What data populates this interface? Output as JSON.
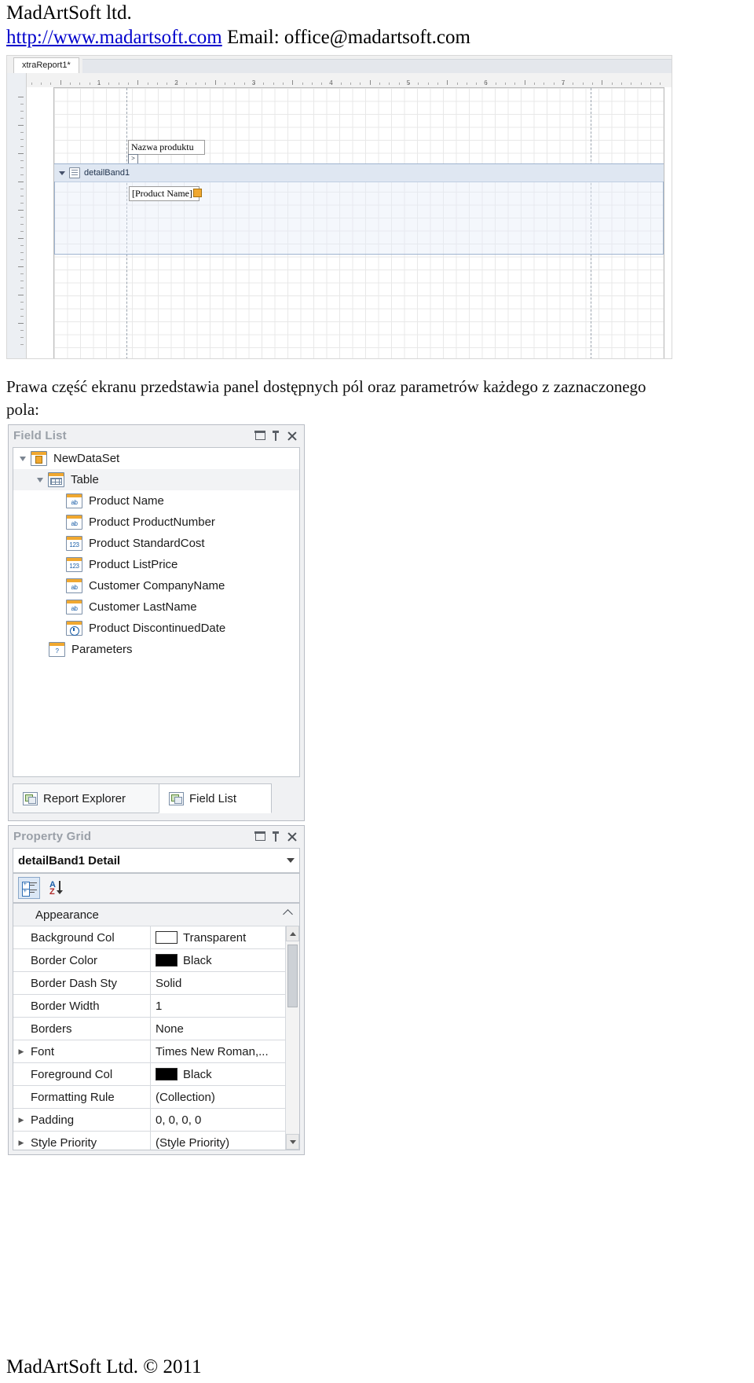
{
  "header": {
    "company": "MadArtSoft ltd.",
    "url": "http://www.madartsoft.com",
    "email_label": "Email: office@madartsoft.com"
  },
  "designer": {
    "tab_label": "xtraReport1*",
    "ruler_numbers": [
      "1",
      "2",
      "3",
      "4",
      "5",
      "6",
      "7"
    ],
    "band_label": "detailBand1",
    "label_control_text": "Nazwa produktu",
    "field_control_text": "[Product Name]",
    "smart_tag_glyph": ">"
  },
  "paragraph": "Prawa część ekranu przedstawia panel dostępnych pól oraz parametrów każdego z zaznaczonego pola:",
  "field_list": {
    "title": "Field List",
    "tree": [
      {
        "label": "NewDataSet",
        "icon": "dataset-icon",
        "indent": 0,
        "expander": true
      },
      {
        "label": "Table",
        "icon": "table-icon",
        "indent": 1,
        "expander": true
      },
      {
        "label": "Product Name",
        "icon": "string-field-icon",
        "indent": 2,
        "expander": false,
        "type": "ab"
      },
      {
        "label": "Product ProductNumber",
        "icon": "string-field-icon",
        "indent": 2,
        "expander": false,
        "type": "ab"
      },
      {
        "label": "Product StandardCost",
        "icon": "number-field-icon",
        "indent": 2,
        "expander": false,
        "type": "123"
      },
      {
        "label": "Product ListPrice",
        "icon": "number-field-icon",
        "indent": 2,
        "expander": false,
        "type": "123"
      },
      {
        "label": "Customer CompanyName",
        "icon": "string-field-icon",
        "indent": 2,
        "expander": false,
        "type": "ab"
      },
      {
        "label": "Customer LastName",
        "icon": "string-field-icon",
        "indent": 2,
        "expander": false,
        "type": "ab"
      },
      {
        "label": "Product DiscontinuedDate",
        "icon": "date-field-icon",
        "indent": 2,
        "expander": false,
        "type": "clock"
      },
      {
        "label": "Parameters",
        "icon": "parameters-icon",
        "indent": 1,
        "expander": false,
        "type": "?"
      }
    ],
    "tabs": [
      {
        "label": "Report Explorer",
        "active": false
      },
      {
        "label": "Field List",
        "active": true
      }
    ]
  },
  "property_grid": {
    "title": "Property Grid",
    "selected_object": "detailBand1  Detail",
    "toolbar": {
      "categorized": "categorized-view-button",
      "alphabetical": "alphabetical-sort-button",
      "az_a": "A",
      "az_z": "Z"
    },
    "category": "Appearance",
    "rows": [
      {
        "name": "Background Col",
        "value": "Transparent",
        "swatch": "#ffffff",
        "expandable": false
      },
      {
        "name": "Border Color",
        "value": "Black",
        "swatch": "#000000",
        "expandable": false
      },
      {
        "name": "Border Dash Sty",
        "value": "Solid",
        "swatch": null,
        "expandable": false
      },
      {
        "name": "Border Width",
        "value": "1",
        "swatch": null,
        "expandable": false
      },
      {
        "name": "Borders",
        "value": "None",
        "swatch": null,
        "expandable": false
      },
      {
        "name": "Font",
        "value": "Times New Roman,...",
        "swatch": null,
        "expandable": true
      },
      {
        "name": "Foreground Col",
        "value": "Black",
        "swatch": "#000000",
        "expandable": false
      },
      {
        "name": "Formatting Rule",
        "value": "(Collection)",
        "swatch": null,
        "expandable": false
      },
      {
        "name": "Padding",
        "value": "0, 0, 0, 0",
        "swatch": null,
        "expandable": true
      },
      {
        "name": "Style Priority",
        "value": "(Style Priority)",
        "swatch": null,
        "expandable": true
      }
    ]
  },
  "footer": "MadArtSoft Ltd. © 2011"
}
